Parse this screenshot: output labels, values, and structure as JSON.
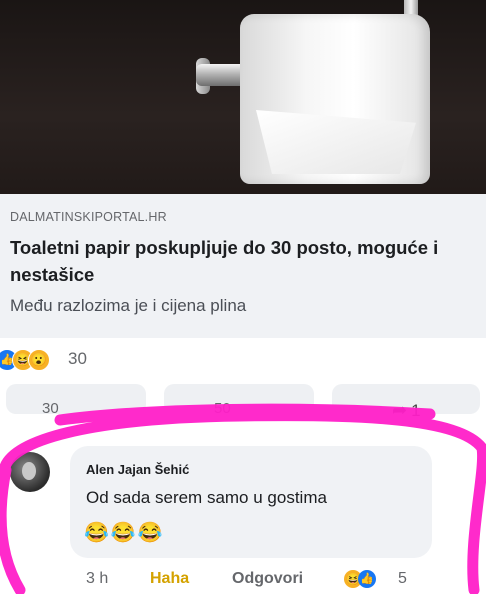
{
  "post": {
    "domain": "DALMATINSKIPORTAL.HR",
    "headline": "Toaletni papir poskupljuje do 30 posto, moguće i nestašice",
    "subtext": "Među razlozima je i cijena plina"
  },
  "reactions": {
    "icons": [
      "like-icon",
      "haha-icon",
      "wow-icon"
    ],
    "count": "30"
  },
  "actions": {
    "like_cut": "30",
    "comment_cut": "50",
    "share_count": "1"
  },
  "comment": {
    "author": "Alen Jajan Šehić",
    "text": "Od sada serem samo u gostima",
    "emoji": "😂😂😂",
    "time": "3 h",
    "haha_label": "Haha",
    "reply_label": "Odgovori",
    "reaction_count": "5"
  },
  "colors": {
    "highlight": "#ff1fc8",
    "haha": "#d4a200",
    "like": "#1877f2"
  }
}
